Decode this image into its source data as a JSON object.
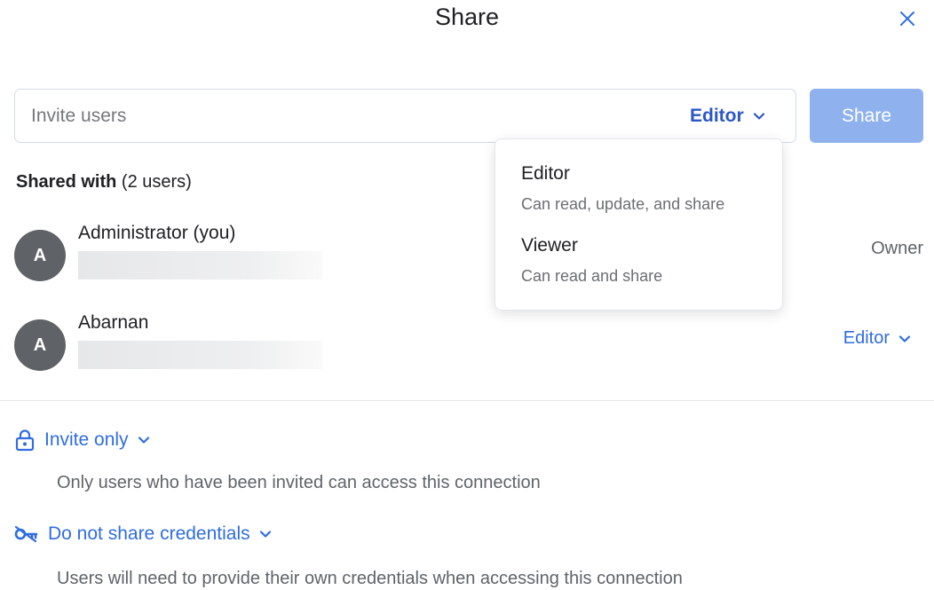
{
  "dialog": {
    "title": "Share",
    "close_label": "×"
  },
  "invite": {
    "placeholder": "Invite users",
    "value": "",
    "role_label": "Editor",
    "share_label": "Share"
  },
  "shared_with": {
    "label": "Shared with",
    "count_text": "(2 users)"
  },
  "users": [
    {
      "initial": "A",
      "name": "Administrator (you)",
      "role": "Owner"
    },
    {
      "initial": "A",
      "name": "Abarnan",
      "role": "Editor"
    }
  ],
  "access": {
    "label": "Invite only",
    "description": "Only users who have been invited can access this connection"
  },
  "credentials": {
    "label": "Do not share credentials",
    "description": "Users will need to provide their own credentials when accessing this connection"
  },
  "role_menu": {
    "items": [
      {
        "title": "Editor",
        "description": "Can read, update, and share"
      },
      {
        "title": "Viewer",
        "description": "Can read and share"
      }
    ]
  },
  "colors": {
    "accent": "#2f6de1",
    "share_button": "#8fb2ee",
    "avatar": "#5f6368"
  },
  "icons": {
    "close": "close-icon",
    "dropdown": "chevron-down-icon",
    "access": "lock-icon",
    "credentials": "key-off-icon"
  }
}
